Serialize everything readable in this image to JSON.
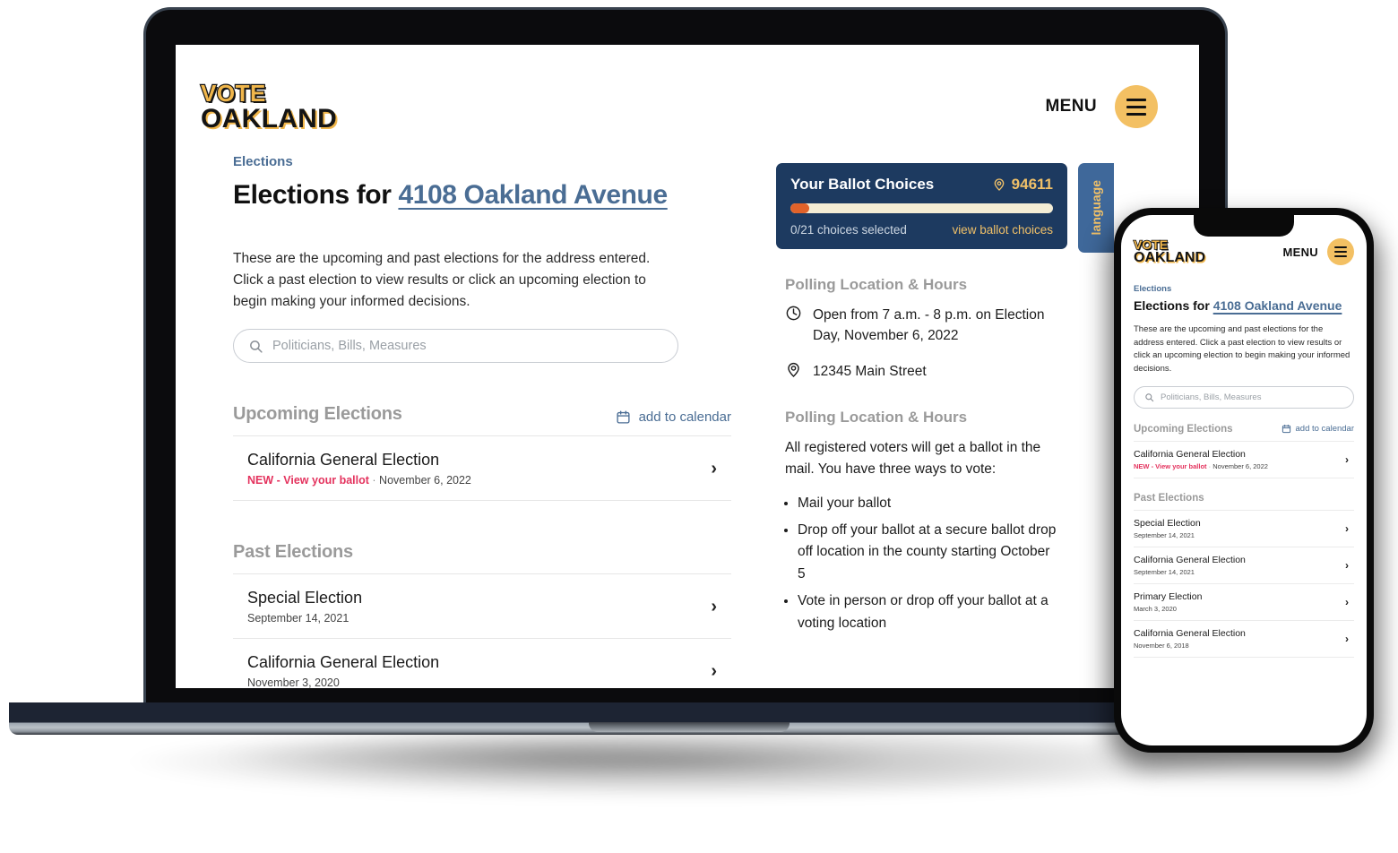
{
  "brand": {
    "logo_line1": "VOTE",
    "logo_line2": "OAKLAND",
    "accent": "#f0b64b"
  },
  "desktop": {
    "header": {
      "menu_label": "MENU",
      "menu_icon": "hamburger-icon"
    },
    "breadcrumb": "Elections",
    "title_prefix": "Elections for ",
    "title_address": "4108 Oakland Avenue",
    "intro": "These are the upcoming and past elections for the address entered. Click a past election to view results or click an upcoming election to begin making your informed decisions.",
    "search": {
      "placeholder": "Politicians, Bills, Measures",
      "value": "",
      "icon": "search-icon"
    },
    "upcoming": {
      "title": "Upcoming Elections",
      "add_to_calendar": "add to calendar",
      "rows": [
        {
          "name": "California General Election",
          "badge": "NEW - View your ballot",
          "sep": "·",
          "date": "November 6, 2022"
        }
      ]
    },
    "past": {
      "title": "Past Elections",
      "rows": [
        {
          "name": "Special Election",
          "date": "September 14, 2021"
        },
        {
          "name": "California General Election",
          "date": "November 3, 2020"
        }
      ]
    },
    "ballot_card": {
      "title": "Your Ballot Choices",
      "zip": "94611",
      "zip_icon": "location-pin-icon",
      "progress_label": "0/21 choices selected",
      "link": "view ballot choices",
      "progress_percent": 7,
      "bg": "#1d3a60",
      "bar_bg": "#f3ecd5",
      "bar_fill": "#e0622a",
      "accent": "#f0c068"
    },
    "language_tab": {
      "label": "language",
      "bg": "#3f689a"
    },
    "polling1": {
      "title": "Polling Location & Hours",
      "hours_icon": "clock-icon",
      "hours": "Open from 7 a.m. - 8 p.m. on Election Day, November 6, 2022",
      "address_icon": "location-pin-icon",
      "address": "12345 Main Street"
    },
    "polling2": {
      "title": "Polling Location & Hours",
      "paragraph": "All registered voters will get a ballot in the mail. You have three ways to vote:",
      "bullets": [
        "Mail your ballot",
        "Drop off your ballot at a secure ballot drop off location in the county starting October 5",
        "Vote in person or drop off your ballot at a voting location"
      ]
    }
  },
  "mobile": {
    "header": {
      "menu_label": "MENU",
      "menu_icon": "hamburger-icon"
    },
    "breadcrumb": "Elections",
    "title_prefix": "Elections for ",
    "title_address": "4108 Oakland Avenue",
    "intro": "These are the upcoming and past elections for the address entered. Click a past election to view results or click an upcoming election to begin making your informed decisions.",
    "search": {
      "placeholder": "Politicians, Bills, Measures",
      "value": "",
      "icon": "search-icon"
    },
    "upcoming": {
      "title": "Upcoming Elections",
      "add_to_calendar": "add to calendar",
      "rows": [
        {
          "name": "California General Election",
          "badge": "NEW - View your ballot",
          "sep": "·",
          "date": "November 6, 2022"
        }
      ]
    },
    "past": {
      "title": "Past Elections",
      "rows": [
        {
          "name": "Special Election",
          "date": "September 14, 2021"
        },
        {
          "name": "California General Election",
          "date": "September 14, 2021"
        },
        {
          "name": "Primary Election",
          "date": "March 3, 2020"
        },
        {
          "name": "California General Election",
          "date": "November 6, 2018"
        }
      ]
    }
  }
}
